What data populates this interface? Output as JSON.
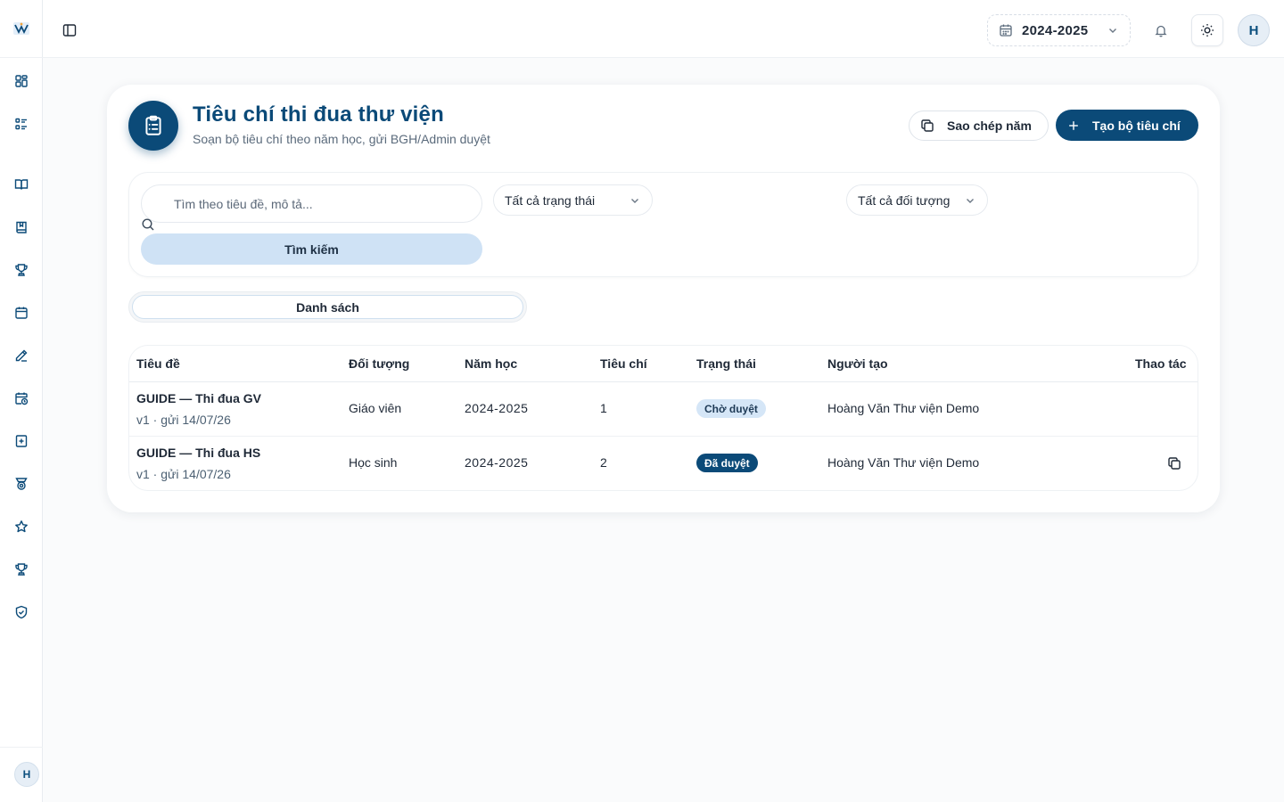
{
  "colors": {
    "primary": "#0b4a78",
    "badge_pending_bg": "#d5e6f7",
    "badge_approved_bg": "#0b4a78",
    "search_button_bg": "#cfe2f5"
  },
  "sidebar": {
    "avatar_initial": "H",
    "icons": [
      "dashboard-icon",
      "list-icon",
      "book-open-icon",
      "book-icon",
      "trophy-icon",
      "calendar-icon",
      "pen-icon",
      "calendar-clock-icon",
      "book-plus-icon",
      "award-icon",
      "star-icon",
      "trophy-icon",
      "shield-check-icon"
    ]
  },
  "topbar": {
    "year_value": "2024-2025",
    "avatar_initial": "H"
  },
  "header": {
    "title": "Tiêu chí thi đua thư viện",
    "subtitle": "Soạn bộ tiêu chí theo năm học, gửi BGH/Admin duyệt",
    "copy_year_label": "Sao chép năm",
    "create_label": "Tạo bộ tiêu chí"
  },
  "filters": {
    "search_placeholder": "Tìm theo tiêu đề, mô tả...",
    "search_value": "",
    "search_button": "Tìm kiếm",
    "status_selected": "Tất cả trạng thái",
    "target_selected": "Tất cả đối tượng"
  },
  "tabs": {
    "active": "Danh sách"
  },
  "table": {
    "headers": {
      "title": "Tiêu đề",
      "target": "Đối tượng",
      "year": "Năm học",
      "criteria": "Tiêu chí",
      "status": "Trạng thái",
      "creator": "Người tạo",
      "actions": "Thao tác"
    },
    "rows": [
      {
        "title": "GUIDE — Thi đua GV",
        "meta": "v1 · gửi 14/07/26",
        "target": "Giáo viên",
        "year": "2024-2025",
        "criteria": "1",
        "status": "Chờ duyệt",
        "creator": "Hoàng Văn Thư viện Demo"
      },
      {
        "title": "GUIDE — Thi đua HS",
        "meta": "v1 · gửi 14/07/26",
        "target": "Học sinh",
        "year": "2024-2025",
        "criteria": "2",
        "status": "Đã duyệt",
        "creator": "Hoàng Văn Thư viện Demo"
      }
    ]
  }
}
